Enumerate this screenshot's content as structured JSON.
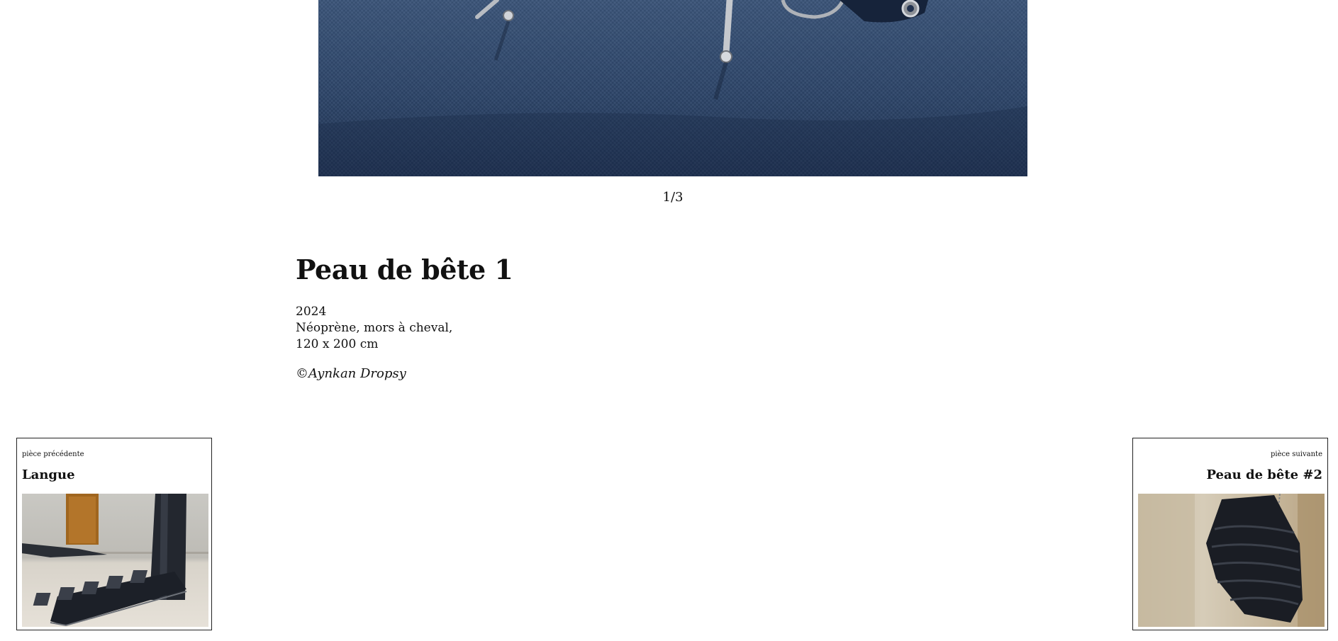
{
  "gallery": {
    "counter": "1/3"
  },
  "artwork": {
    "title": "Peau de bête 1",
    "year": "2024",
    "materials": "Néoprène, mors à cheval,",
    "dimensions": "120 x 200 cm",
    "credit": "©Aynkan Dropsy"
  },
  "prev_piece": {
    "kicker": "pièce précédente",
    "title": "Langue"
  },
  "next_piece": {
    "kicker": "pièce suivante",
    "title": "Peau de bête #2"
  },
  "colors": {
    "hero_fabric": "#2c4468",
    "text": "#111111",
    "card_border": "#222222"
  }
}
